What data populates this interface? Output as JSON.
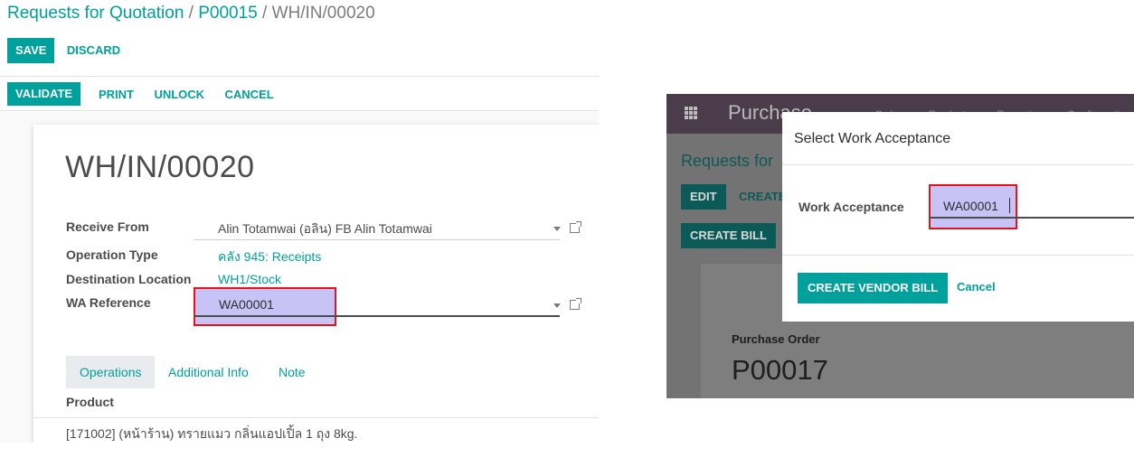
{
  "left": {
    "breadcrumb": {
      "item1": "Requests for Quotation",
      "sep1": " / ",
      "item2": "P00015",
      "sep2": " / ",
      "item3": "WH/IN/00020"
    },
    "toolbar": {
      "save_label": "SAVE",
      "discard_label": "DISCARD"
    },
    "status_bar": {
      "validate_label": "VALIDATE",
      "print_label": "PRINT",
      "unlock_label": "UNLOCK",
      "cancel_label": "CANCEL"
    },
    "record_title": "WH/IN/00020",
    "fields": {
      "receive_from": {
        "label": "Receive From",
        "value": "Alin Totamwai (อลิน) FB Alin Totamwai"
      },
      "operation_type": {
        "label": "Operation Type",
        "value": "คลัง 945: Receipts"
      },
      "destination_location": {
        "label": "Destination Location",
        "value": "WH1/Stock"
      },
      "wa_reference": {
        "label": "WA Reference",
        "value": "WA00001"
      }
    },
    "tabs": [
      {
        "label": "Operations",
        "active": true
      },
      {
        "label": "Additional Info",
        "active": false
      },
      {
        "label": "Note",
        "active": false
      }
    ],
    "product_header": "Product",
    "product_row": "[171002] (หน้าร้าน) ทรายแมว กลิ่นแอปเปิ้ล 1 ถุง 8kg."
  },
  "right": {
    "app_name": "Purchase",
    "menu": [
      "Orders",
      "Products",
      "Reporting",
      "Configuration"
    ],
    "breadcrumb": "Requests for",
    "edit_label": "EDIT",
    "create_label": "CREATE",
    "create_bill_label": "CREATE BILL",
    "po_label": "Purchase Order",
    "po_name": "P00017",
    "modal": {
      "title": "Select Work Acceptance",
      "field_label": "Work Acceptance",
      "field_value": "WA00001",
      "create_vendor_bill_label": "CREATE VENDOR BILL",
      "cancel_label": "Cancel"
    }
  },
  "colors": {
    "accent": "#00a09d",
    "highlight": "#c7c3f7",
    "annotation_border": "#e5141c",
    "navbar": "#4a3c4a"
  }
}
